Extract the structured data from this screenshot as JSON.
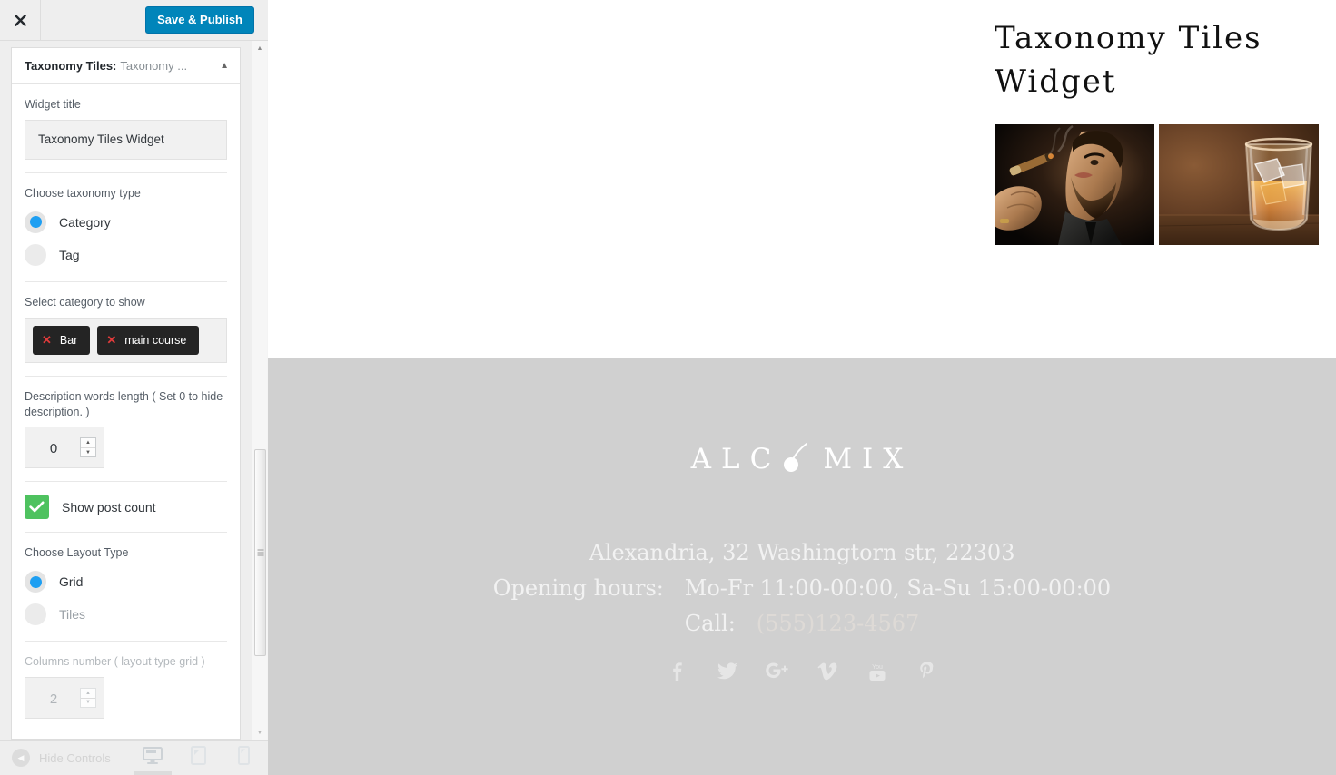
{
  "customizer": {
    "close_icon": "close-icon",
    "save_label": "Save & Publish",
    "panel": {
      "title_strong": "Taxonomy Tiles:",
      "title_light": "Taxonomy ...",
      "collapse_icon": "chevron-up-icon"
    },
    "fields": {
      "widget_title": {
        "label": "Widget title",
        "value": "Taxonomy Tiles Widget",
        "placeholder": "Widget title"
      },
      "taxonomy_type": {
        "label": "Choose taxonomy type",
        "options": [
          {
            "label": "Category",
            "selected": true
          },
          {
            "label": "Tag",
            "selected": false
          }
        ]
      },
      "select_category": {
        "label": "Select category to show",
        "tags": [
          {
            "label": "Bar",
            "remove_icon": "remove-icon"
          },
          {
            "label": "main course",
            "remove_icon": "remove-icon"
          }
        ]
      },
      "description_length": {
        "label": "Description words length ( Set 0 to hide description. )",
        "value": "0"
      },
      "show_post_count": {
        "label": "Show post count",
        "checked": true,
        "check_icon": "check-icon"
      },
      "layout_type": {
        "label": "Choose Layout Type",
        "options": [
          {
            "label": "Grid",
            "selected": true
          },
          {
            "label": "Tiles",
            "selected": false
          }
        ]
      },
      "columns_number": {
        "label": "Columns number ( layout type grid )",
        "value": "2",
        "disabled": true
      }
    },
    "bottom": {
      "hide_controls_label": "Hide Controls",
      "back_icon": "chevron-left-icon",
      "devices": [
        {
          "name": "desktop",
          "icon": "desktop-icon",
          "active": true
        },
        {
          "name": "tablet",
          "icon": "tablet-icon",
          "active": false
        },
        {
          "name": "mobile",
          "icon": "mobile-icon",
          "active": false
        }
      ]
    }
  },
  "preview": {
    "widget": {
      "heading": "Taxonomy Tiles Widget",
      "tiles": [
        {
          "name": "bar-tile",
          "alt": "man smoking cigar"
        },
        {
          "name": "main-course-tile",
          "alt": "whiskey glass with ice"
        }
      ]
    },
    "footer": {
      "logo": {
        "before": "ALC",
        "after": "MIX",
        "cherry_icon": "cherry-icon"
      },
      "address": "Alexandria, 32 Washingtorn str, 22303",
      "hours_label": "Opening hours:",
      "hours_value": "Mo-Fr 11:00-00:00, Sa-Su 15:00-00:00",
      "call_label": "Call:",
      "phone": "(555)123-4567",
      "social": [
        {
          "name": "facebook",
          "icon": "facebook-icon"
        },
        {
          "name": "twitter",
          "icon": "twitter-icon"
        },
        {
          "name": "googleplus",
          "icon": "googleplus-icon"
        },
        {
          "name": "vimeo",
          "icon": "vimeo-icon"
        },
        {
          "name": "youtube",
          "icon": "youtube-icon"
        },
        {
          "name": "pinterest",
          "icon": "pinterest-icon"
        }
      ]
    }
  },
  "colors": {
    "accent_blue": "#0085ba",
    "radio_blue": "#1e9ff2",
    "check_green": "#4ec25f",
    "tag_dark": "#242424",
    "tag_remove_red": "#e03b3b",
    "footer_gray": "#d0d0d0"
  }
}
